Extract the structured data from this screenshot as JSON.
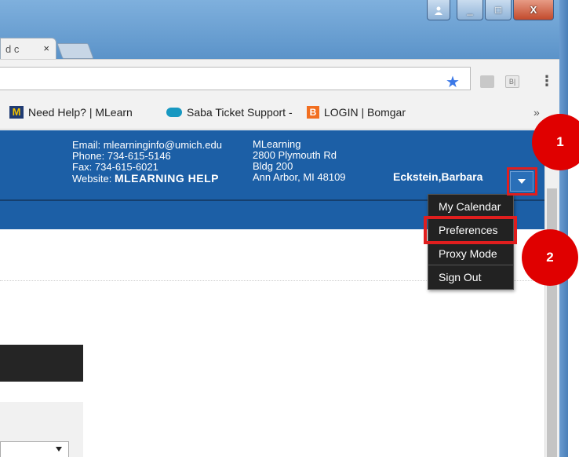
{
  "browser": {
    "tab_title": "d c",
    "tab_close": "×",
    "win_min": "_",
    "win_max": "□",
    "win_close": "X",
    "ext_label": "B|",
    "bookmarks": [
      {
        "label": "Need Help? | MLearn",
        "icon": "m-logo-icon",
        "icon_text": "M"
      },
      {
        "label": "Saba Ticket Support -",
        "icon": "cloud-icon",
        "icon_text": ""
      },
      {
        "label": "LOGIN | Bomgar",
        "icon": "bomgar-icon",
        "icon_text": "B"
      }
    ],
    "more_bookmarks": "»"
  },
  "header": {
    "email": "Email: mlearninginfo@umich.edu",
    "phone": "Phone: 734-615-5146",
    "fax": "Fax: 734-615-6021",
    "website_label": "Website: ",
    "website_name": "MLEARNING HELP",
    "address_line1": "MLearning",
    "address_line2": "2800 Plymouth Rd",
    "address_line3": "Bldg 200",
    "address_line4": "Ann Arbor, MI 48109",
    "user_name": "Eckstein,Barbara"
  },
  "menu": {
    "items": [
      "My Calendar",
      "Preferences",
      "Proxy Mode",
      "Sign Out"
    ]
  },
  "callouts": {
    "first": "1",
    "second": "2"
  },
  "colors": {
    "header_blue": "#1c5fa6",
    "highlight_red": "#e01e1e",
    "menu_bg": "#222222"
  }
}
